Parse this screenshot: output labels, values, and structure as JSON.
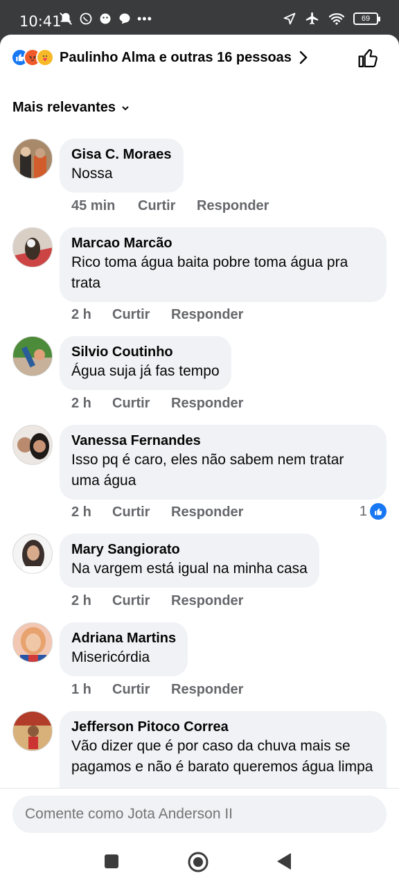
{
  "status_bar": {
    "time": "10:41",
    "battery": "69"
  },
  "reactions_bar": {
    "text": "Paulinho Alma e outras 16 pessoas"
  },
  "sort": {
    "label": "Mais relevantes"
  },
  "comments": [
    {
      "author": "Gisa C. Moraes",
      "text": "Nossa",
      "time": "45 min",
      "like_label": "Curtir",
      "reply_label": "Responder"
    },
    {
      "author": "Marcao Marcão",
      "text": "Rico toma água baita pobre toma água pra trata",
      "time": "2 h",
      "like_label": "Curtir",
      "reply_label": "Responder"
    },
    {
      "author": "Silvio Coutinho",
      "text": "Água suja já fas tempo",
      "time": "2 h",
      "like_label": "Curtir",
      "reply_label": "Responder"
    },
    {
      "author": "Vanessa Fernandes",
      "text": "Isso pq é caro, eles não sabem nem tratar uma água",
      "time": "2 h",
      "like_label": "Curtir",
      "reply_label": "Responder",
      "likes": "1"
    },
    {
      "author": "Mary Sangiorato",
      "text": "Na vargem está igual na minha casa",
      "time": "2 h",
      "like_label": "Curtir",
      "reply_label": "Responder"
    },
    {
      "author": "Adriana Martins",
      "text": "Misericórdia",
      "time": "1 h",
      "like_label": "Curtir",
      "reply_label": "Responder"
    },
    {
      "author": "Jefferson Pitoco Correa",
      "text": "Vão dizer que é por caso da chuva mais se pagamos e não é barato queremos água limpa"
    }
  ],
  "composer": {
    "placeholder": "Comente como Jota Anderson II"
  },
  "colors": {
    "accent": "#1877f2",
    "bubble": "#f0f2f5",
    "muted": "#65676b"
  }
}
